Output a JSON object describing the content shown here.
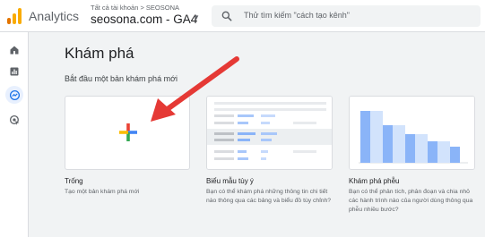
{
  "header": {
    "app_name": "Analytics",
    "account_path": "Tất cả tài khoản > SEOSONA",
    "property": "seosona.com - GA4",
    "search_placeholder": "Thử tìm kiếm \"cách tạo kênh\""
  },
  "rail": {
    "items": [
      {
        "icon": "home-icon",
        "active": false
      },
      {
        "icon": "reports-icon",
        "active": false
      },
      {
        "icon": "explore-icon",
        "active": true
      },
      {
        "icon": "advertising-icon",
        "active": false
      }
    ]
  },
  "main": {
    "title": "Khám phá",
    "subtitle": "Bắt đầu một bản khám phá mới",
    "cards": [
      {
        "title": "Trống",
        "desc_lines": [
          "Tạo một bản khám phá mới"
        ]
      },
      {
        "title": "Biểu mẫu tùy ý",
        "desc_lines": [
          "Bạn có thể khám phá những thông tin chi tiết",
          "nào thông qua các bảng và biểu đồ tùy chỉnh?"
        ]
      },
      {
        "title": "Khám phá phễu",
        "desc_lines": [
          "Bạn có thể phân tích, phân đoạn và chia nhỏ",
          "các hành trình nào của người dùng thông qua",
          "phễu nhiều bước?"
        ]
      }
    ]
  },
  "colors": {
    "accent_blue": "#1a73e8",
    "arrow_red": "#e53935",
    "google_red": "#ea4335",
    "google_yellow": "#fbbc04",
    "google_green": "#34a853",
    "google_blue": "#4285f4",
    "logo_orange": "#f9ab00",
    "logo_dark_orange": "#e37400"
  }
}
